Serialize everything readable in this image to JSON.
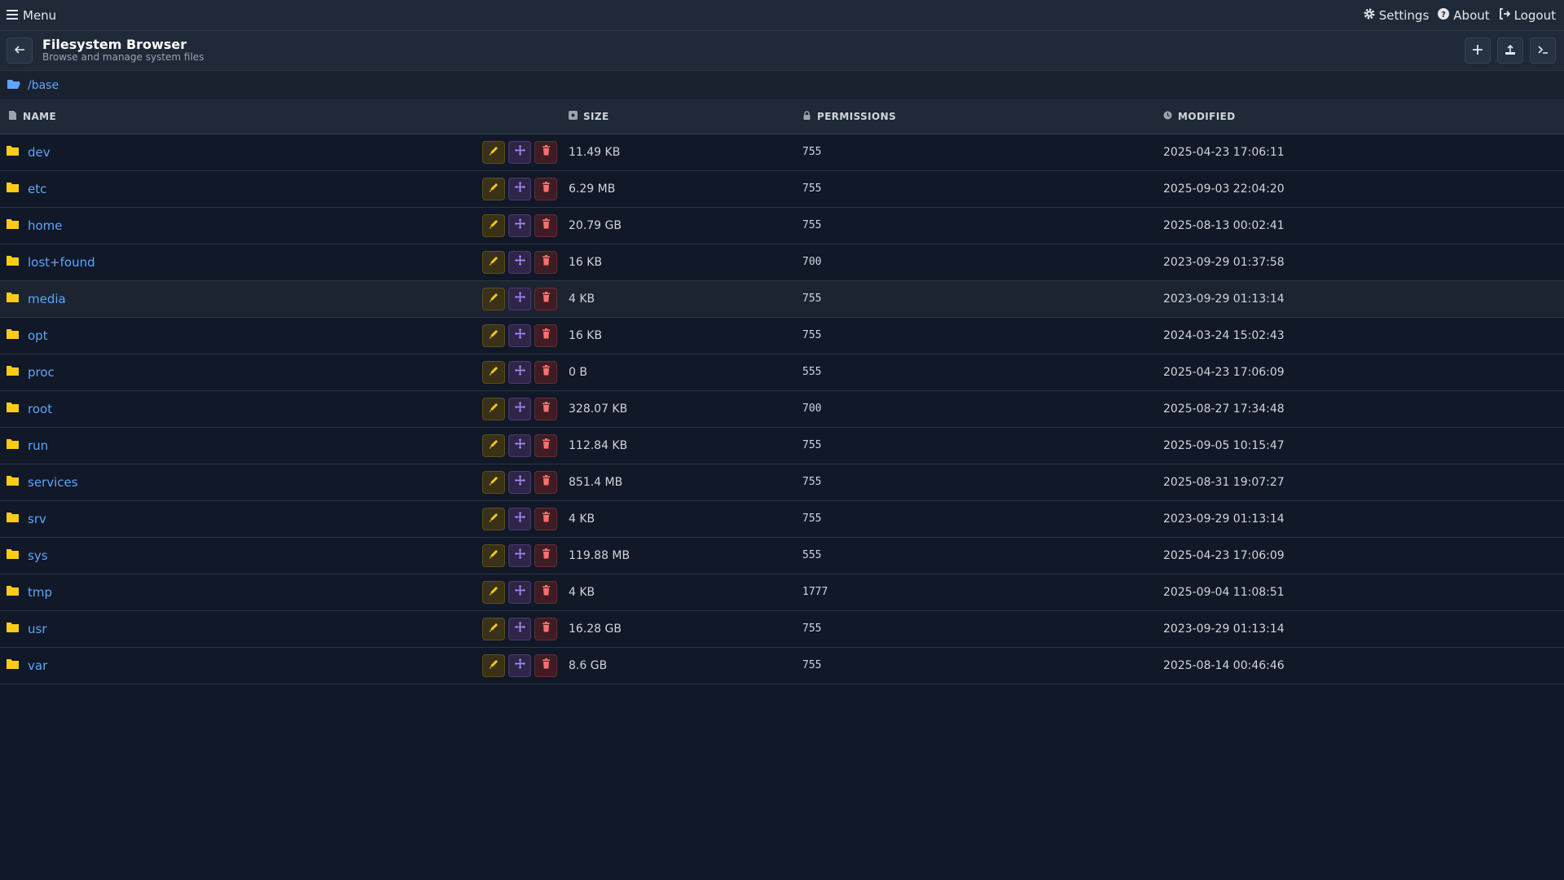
{
  "topbar": {
    "menu_label": "Menu",
    "settings_label": "Settings",
    "about_label": "About",
    "logout_label": "Logout"
  },
  "header": {
    "title": "Filesystem Browser",
    "subtitle": "Browse and manage system files",
    "buttons": [
      "plus-icon",
      "upload-icon",
      "terminal-icon"
    ]
  },
  "path": "/base",
  "table": {
    "headers": {
      "name": "NAME",
      "size": "SIZE",
      "permissions": "PERMISSIONS",
      "modified": "MODIFIED"
    },
    "rows": [
      {
        "name": "dev",
        "size": "11.49 KB",
        "perm": "755",
        "modified": "2025-04-23 17:06:11"
      },
      {
        "name": "etc",
        "size": "6.29 MB",
        "perm": "755",
        "modified": "2025-09-03 22:04:20"
      },
      {
        "name": "home",
        "size": "20.79 GB",
        "perm": "755",
        "modified": "2025-08-13 00:02:41"
      },
      {
        "name": "lost+found",
        "size": "16 KB",
        "perm": "700",
        "modified": "2023-09-29 01:37:58"
      },
      {
        "name": "media",
        "size": "4 KB",
        "perm": "755",
        "modified": "2023-09-29 01:13:14"
      },
      {
        "name": "opt",
        "size": "16 KB",
        "perm": "755",
        "modified": "2024-03-24 15:02:43"
      },
      {
        "name": "proc",
        "size": "0 B",
        "perm": "555",
        "modified": "2025-04-23 17:06:09"
      },
      {
        "name": "root",
        "size": "328.07 KB",
        "perm": "700",
        "modified": "2025-08-27 17:34:48"
      },
      {
        "name": "run",
        "size": "112.84 KB",
        "perm": "755",
        "modified": "2025-09-05 10:15:47"
      },
      {
        "name": "services",
        "size": "851.4 MB",
        "perm": "755",
        "modified": "2025-08-31 19:07:27"
      },
      {
        "name": "srv",
        "size": "4 KB",
        "perm": "755",
        "modified": "2023-09-29 01:13:14"
      },
      {
        "name": "sys",
        "size": "119.88 MB",
        "perm": "555",
        "modified": "2025-04-23 17:06:09"
      },
      {
        "name": "tmp",
        "size": "4 KB",
        "perm": "1777",
        "modified": "2025-09-04 11:08:51"
      },
      {
        "name": "usr",
        "size": "16.28 GB",
        "perm": "755",
        "modified": "2023-09-29 01:13:14"
      },
      {
        "name": "var",
        "size": "8.6 GB",
        "perm": "755",
        "modified": "2025-08-14 00:46:46"
      }
    ],
    "hovered_row": "media"
  },
  "colors": {
    "background": "#111827",
    "link": "#60a5fa",
    "folder": "#facc15",
    "edit": "#facc15",
    "move": "#a78bfa",
    "delete": "#f87171"
  }
}
